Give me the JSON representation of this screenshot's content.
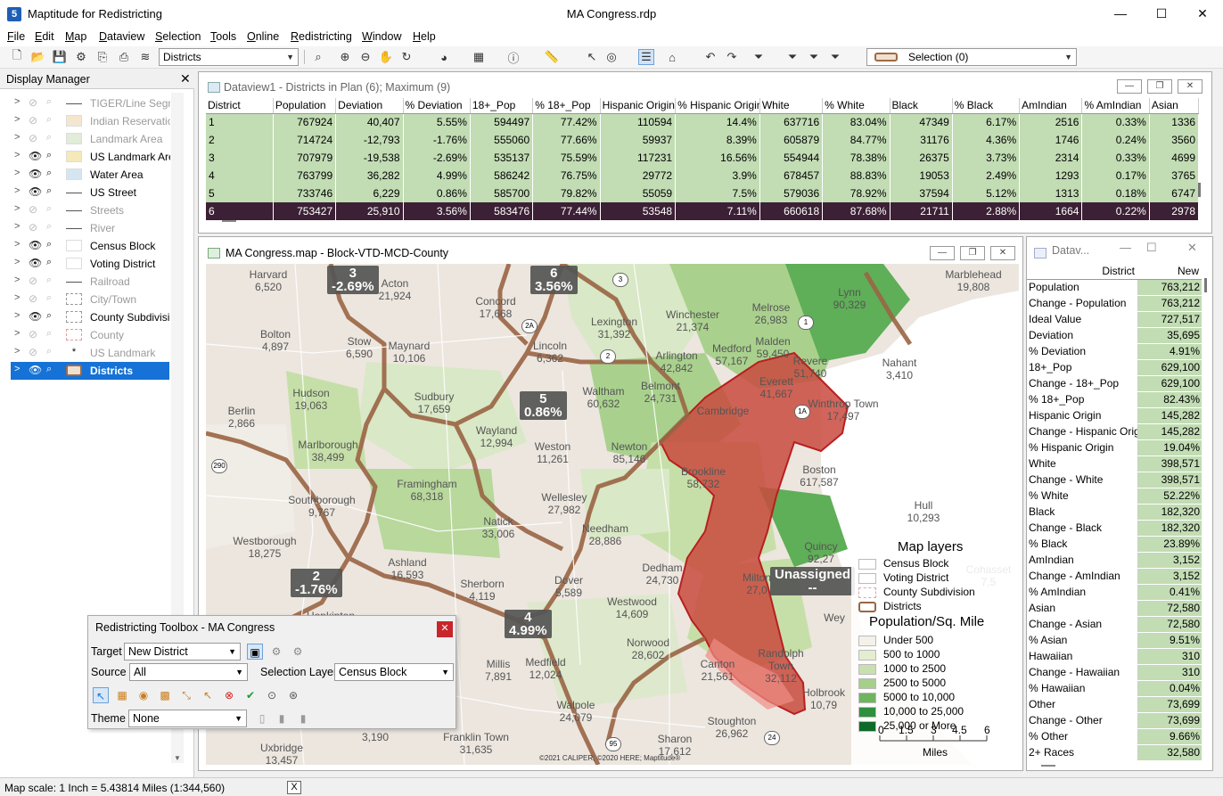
{
  "app": {
    "name": "Maptitude for Redistricting",
    "document": "MA Congress.rdp",
    "logo_letter": "5"
  },
  "menu": [
    "File",
    "Edit",
    "Map",
    "Dataview",
    "Selection",
    "Tools",
    "Online",
    "Redistricting",
    "Window",
    "Help"
  ],
  "toolbar": {
    "layer_combo": "Districts",
    "selection_combo": "Selection (0)"
  },
  "display_manager": {
    "title": "Display Manager",
    "layers": [
      {
        "name": "TIGER/Line Segm",
        "visible": false,
        "swatch": "line"
      },
      {
        "name": "Indian Reservatio",
        "visible": false,
        "swatch": "#f5e6d0"
      },
      {
        "name": "Landmark Area",
        "visible": false,
        "swatch": "#e2ecd8"
      },
      {
        "name": "US Landmark Are",
        "visible": true,
        "swatch": "#f6e9b8"
      },
      {
        "name": "Water Area",
        "visible": true,
        "swatch": "#d5e6f2"
      },
      {
        "name": "US Street",
        "visible": true,
        "swatch": "line"
      },
      {
        "name": "Streets",
        "visible": false,
        "swatch": "line"
      },
      {
        "name": "River",
        "visible": false,
        "swatch": "line"
      },
      {
        "name": "Census Block",
        "visible": true,
        "swatch": "#ffffff"
      },
      {
        "name": "Voting District",
        "visible": true,
        "swatch": "#ffffff"
      },
      {
        "name": "Railroad",
        "visible": false,
        "swatch": "line"
      },
      {
        "name": "City/Town",
        "visible": false,
        "swatch": "dash"
      },
      {
        "name": "County Subdivisi",
        "visible": true,
        "swatch": "dash"
      },
      {
        "name": "County",
        "visible": false,
        "swatch": "pinkdash"
      },
      {
        "name": "US Landmark",
        "visible": false,
        "swatch": "star"
      },
      {
        "name": "Districts",
        "visible": true,
        "swatch": "district",
        "selected": true
      }
    ]
  },
  "status": {
    "text": "Map scale: 1 Inch = 5.43814 Miles (1:344,560)",
    "close": "X"
  },
  "dataview1": {
    "title": "Dataview1 - Districts in Plan (6); Maximum (9)",
    "columns": [
      "District",
      "Population",
      "Deviation",
      "% Deviation",
      "18+_Pop",
      "% 18+_Pop",
      "Hispanic Origin",
      "% Hispanic Origin",
      "White",
      "% White",
      "Black",
      "% Black",
      "AmIndian",
      "% AmIndian",
      "Asian"
    ],
    "rows": [
      [
        "1",
        "767924",
        "40,407",
        "5.55%",
        "594497",
        "77.42%",
        "110594",
        "14.4%",
        "637716",
        "83.04%",
        "47349",
        "6.17%",
        "2516",
        "0.33%",
        "1336"
      ],
      [
        "2",
        "714724",
        "-12,793",
        "-1.76%",
        "555060",
        "77.66%",
        "59937",
        "8.39%",
        "605879",
        "84.77%",
        "31176",
        "4.36%",
        "1746",
        "0.24%",
        "3560"
      ],
      [
        "3",
        "707979",
        "-19,538",
        "-2.69%",
        "535137",
        "75.59%",
        "117231",
        "16.56%",
        "554944",
        "78.38%",
        "26375",
        "3.73%",
        "2314",
        "0.33%",
        "4699"
      ],
      [
        "4",
        "763799",
        "36,282",
        "4.99%",
        "586242",
        "76.75%",
        "29772",
        "3.9%",
        "678457",
        "88.83%",
        "19053",
        "2.49%",
        "1293",
        "0.17%",
        "3765"
      ],
      [
        "5",
        "733746",
        "6,229",
        "0.86%",
        "585700",
        "79.82%",
        "55059",
        "7.5%",
        "579036",
        "78.92%",
        "37594",
        "5.12%",
        "1313",
        "0.18%",
        "6747"
      ],
      [
        "6",
        "753427",
        "25,910",
        "3.56%",
        "583476",
        "77.44%",
        "53548",
        "7.11%",
        "660618",
        "87.68%",
        "21711",
        "2.88%",
        "1664",
        "0.22%",
        "2978"
      ]
    ]
  },
  "map": {
    "title": "MA Congress.map - Block-VTD-MCD-County",
    "places": [
      {
        "name": "Harvard",
        "value": "6,520"
      },
      {
        "name": "Acton",
        "value": "21,924"
      },
      {
        "name": "Concord",
        "value": "17,668"
      },
      {
        "name": "Lexington",
        "value": "31,392"
      },
      {
        "name": "Winchester",
        "value": "21,374"
      },
      {
        "name": "Melrose",
        "value": "26,983"
      },
      {
        "name": "Lynn",
        "value": "90,329"
      },
      {
        "name": "Marblehead",
        "value": "19,808"
      },
      {
        "name": "Bolton",
        "value": "4,897"
      },
      {
        "name": "Stow",
        "value": "6,590"
      },
      {
        "name": "Maynard",
        "value": "10,106"
      },
      {
        "name": "Lincoln",
        "value": "6,362"
      },
      {
        "name": "Arlington",
        "value": "42,842"
      },
      {
        "name": "Medford",
        "value": "57,167"
      },
      {
        "name": "Malden",
        "value": "59,450"
      },
      {
        "name": "Revere",
        "value": "51,740"
      },
      {
        "name": "Nahant",
        "value": "3,410"
      },
      {
        "name": "Everett",
        "value": "41,667"
      },
      {
        "name": "Belmont",
        "value": "24,731"
      },
      {
        "name": "Cambridge",
        "value": ""
      },
      {
        "name": "Winthrop Town",
        "value": "17,497"
      },
      {
        "name": "Hudson",
        "value": "19,063"
      },
      {
        "name": "Sudbury",
        "value": "17,659"
      },
      {
        "name": "Waltham",
        "value": "60,632"
      },
      {
        "name": "Berlin",
        "value": "2,866"
      },
      {
        "name": "Marlborough",
        "value": "38,499"
      },
      {
        "name": "Wayland",
        "value": "12,994"
      },
      {
        "name": "Weston",
        "value": "11,261"
      },
      {
        "name": "Newton",
        "value": "85,146"
      },
      {
        "name": "Brookline",
        "value": "58,732"
      },
      {
        "name": "Boston",
        "value": "617,587"
      },
      {
        "name": "Framingham",
        "value": "68,318"
      },
      {
        "name": "Wellesley",
        "value": "27,982"
      },
      {
        "name": "Southborough",
        "value": "9,767"
      },
      {
        "name": "Natick",
        "value": "33,006"
      },
      {
        "name": "Needham",
        "value": "28,886"
      },
      {
        "name": "Hull",
        "value": "10,293"
      },
      {
        "name": "Westborough",
        "value": "18,275"
      },
      {
        "name": "Quincy",
        "value": "92,27"
      },
      {
        "name": "Ashland",
        "value": "16,593"
      },
      {
        "name": "Dedham",
        "value": "24,730"
      },
      {
        "name": "Milton",
        "value": "27,0"
      },
      {
        "name": "Sherborn",
        "value": "4,119"
      },
      {
        "name": "Dover",
        "value": "5,589"
      },
      {
        "name": "Westwood",
        "value": "14,609"
      },
      {
        "name": "Hopkinton",
        "value": ""
      },
      {
        "name": "Norwood",
        "value": "28,602"
      },
      {
        "name": "Millis",
        "value": "7,891"
      },
      {
        "name": "Medfield",
        "value": "12,024"
      },
      {
        "name": "Canton",
        "value": "21,561"
      },
      {
        "name": "Randolph Town",
        "value": "32,112"
      },
      {
        "name": "Holbrook",
        "value": "10,79"
      },
      {
        "name": "Walpole",
        "value": "24,079"
      },
      {
        "name": "Franklin Town",
        "value": "31,635"
      },
      {
        "name": "Sharon",
        "value": "17,612"
      },
      {
        "name": "Stoughton",
        "value": "26,962"
      },
      {
        "name": "Uxbridge",
        "value": "13,457"
      },
      {
        "name": "Millville",
        "value": "3,190"
      },
      {
        "name": "Cohasset",
        "value": "7,5"
      },
      {
        "name": "Wey",
        "value": ""
      }
    ],
    "district_labels": [
      {
        "name": "3",
        "value": "-2.69%"
      },
      {
        "name": "6",
        "value": "3.56%"
      },
      {
        "name": "5",
        "value": "0.86%"
      },
      {
        "name": "2",
        "value": "-1.76%"
      },
      {
        "name": "4",
        "value": "4.99%"
      },
      {
        "name": "Unassigned",
        "value": "--"
      }
    ],
    "route_shields": [
      "2A",
      "3",
      "1",
      "2",
      "1A",
      "290",
      "95",
      "24"
    ],
    "legend": {
      "title1": "Map layers",
      "layers": [
        "Census Block",
        "Voting District",
        "County Subdivision",
        "Districts"
      ],
      "title2": "Population/Sq. Mile",
      "bins": [
        {
          "label": "Under 500",
          "color": "#f4f1ea"
        },
        {
          "label": "500 to 1000",
          "color": "#e4edcf"
        },
        {
          "label": "1000 to 2500",
          "color": "#c9e0ae"
        },
        {
          "label": "2500 to 5000",
          "color": "#a6cf8a"
        },
        {
          "label": "5000 to 10,000",
          "color": "#6fb55f"
        },
        {
          "label": "10,000 to 25,000",
          "color": "#2f8f3e"
        },
        {
          "label": "25,000 or More",
          "color": "#0d6a2a"
        }
      ],
      "scale_ticks": [
        "0",
        "1.5",
        "3",
        "4.5",
        "6"
      ],
      "scale_unit": "Miles"
    },
    "copyright": "©2021 CALIPER; ©2020 HERE; Maptitude®"
  },
  "dataview2": {
    "title": "Datav...",
    "col_district": "District",
    "col_new": "New",
    "rows": [
      [
        "Population",
        "763,212"
      ],
      [
        "Change - Population",
        "763,212"
      ],
      [
        "Ideal Value",
        "727,517"
      ],
      [
        "Deviation",
        "35,695"
      ],
      [
        "% Deviation",
        "4.91%"
      ],
      [
        "18+_Pop",
        "629,100"
      ],
      [
        "Change - 18+_Pop",
        "629,100"
      ],
      [
        "% 18+_Pop",
        "82.43%"
      ],
      [
        "Hispanic Origin",
        "145,282"
      ],
      [
        "Change - Hispanic Origin",
        "145,282"
      ],
      [
        "% Hispanic Origin",
        "19.04%"
      ],
      [
        "White",
        "398,571"
      ],
      [
        "Change - White",
        "398,571"
      ],
      [
        "% White",
        "52.22%"
      ],
      [
        "Black",
        "182,320"
      ],
      [
        "Change - Black",
        "182,320"
      ],
      [
        "% Black",
        "23.89%"
      ],
      [
        "AmIndian",
        "3,152"
      ],
      [
        "Change - AmIndian",
        "3,152"
      ],
      [
        "% AmIndian",
        "0.41%"
      ],
      [
        "Asian",
        "72,580"
      ],
      [
        "Change - Asian",
        "72,580"
      ],
      [
        "% Asian",
        "9.51%"
      ],
      [
        "Hawaiian",
        "310"
      ],
      [
        "Change - Hawaiian",
        "310"
      ],
      [
        "% Hawaiian",
        "0.04%"
      ],
      [
        "Other",
        "73,699"
      ],
      [
        "Change - Other",
        "73,699"
      ],
      [
        "% Other",
        "9.66%"
      ],
      [
        "2+ Races",
        "32,580"
      ]
    ]
  },
  "toolbox": {
    "title": "Redistricting Toolbox - MA Congress",
    "target_label": "Target",
    "target_value": "New District",
    "source_label": "Source",
    "source_value": "All",
    "selection_layer_label": "Selection Layer",
    "selection_layer_value": "Census Block",
    "theme_label": "Theme",
    "theme_value": "None"
  }
}
